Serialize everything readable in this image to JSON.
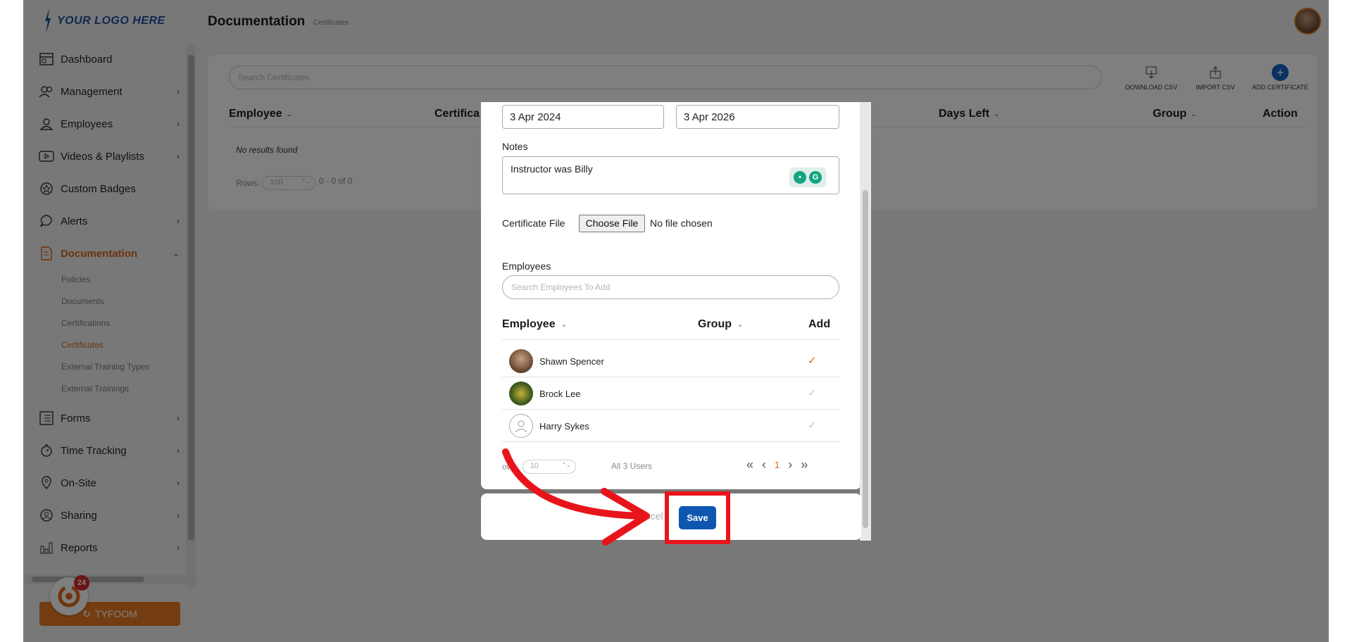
{
  "header": {
    "logo_text": "YOUR LOGO HERE",
    "title": "Documentation",
    "subtitle": "Certificates"
  },
  "sidebar": {
    "items": [
      {
        "label": "Dashboard",
        "icon": "dashboard-icon"
      },
      {
        "label": "Management",
        "icon": "users-icon"
      },
      {
        "label": "Employees",
        "icon": "person-icon"
      },
      {
        "label": "Videos & Playlists",
        "icon": "play-icon"
      },
      {
        "label": "Custom Badges",
        "icon": "badge-icon"
      },
      {
        "label": "Alerts",
        "icon": "chat-icon"
      },
      {
        "label": "Documentation",
        "icon": "document-icon"
      },
      {
        "label": "Forms",
        "icon": "list-icon"
      },
      {
        "label": "Time Tracking",
        "icon": "stopwatch-icon"
      },
      {
        "label": "On-Site",
        "icon": "location-icon"
      },
      {
        "label": "Sharing",
        "icon": "share-icon"
      },
      {
        "label": "Reports",
        "icon": "chart-icon"
      }
    ],
    "documentation_sub": [
      "Policies",
      "Documents",
      "Certifications",
      "Certificates",
      "External Training Types",
      "External Trainings"
    ],
    "tyfoom_button": "TYFOOM",
    "chat_badge_count": "24"
  },
  "main": {
    "search_placeholder": "Search Certificates",
    "tools": [
      "DOWNLOAD CSV",
      "IMPORT CSV",
      "ADD CERTIFICATE"
    ],
    "columns": [
      "Employee",
      "Certifica",
      "Days Left",
      "Group",
      "Action"
    ],
    "no_results": "No results found",
    "rows_label": "Rows:",
    "rows_value": "100",
    "range": "0 - 0 of 0"
  },
  "modal": {
    "start_date": "3 Apr 2024",
    "end_date": "3 Apr 2026",
    "notes_label": "Notes",
    "notes_value": "Instructor was Billy",
    "cert_file_label": "Certificate File",
    "choose_file": "Choose File",
    "no_file": "No file chosen",
    "employees_label": "Employees",
    "employees_placeholder": "Search Employees To Add",
    "columns": [
      "Employee",
      "Group",
      "Add"
    ],
    "employees": [
      {
        "name": "Shawn Spencer",
        "added": true
      },
      {
        "name": "Brock Lee",
        "added": false
      },
      {
        "name": "Harry Sykes",
        "added": false
      }
    ],
    "rows_label": "ows:",
    "rows_value": "10",
    "total": "All 3 Users",
    "current_page": "1",
    "cancel": "Cancel",
    "save": "Save"
  },
  "colors": {
    "accent": "#d8661a",
    "primary": "#0d57b1",
    "highlight": "#e8141b"
  }
}
